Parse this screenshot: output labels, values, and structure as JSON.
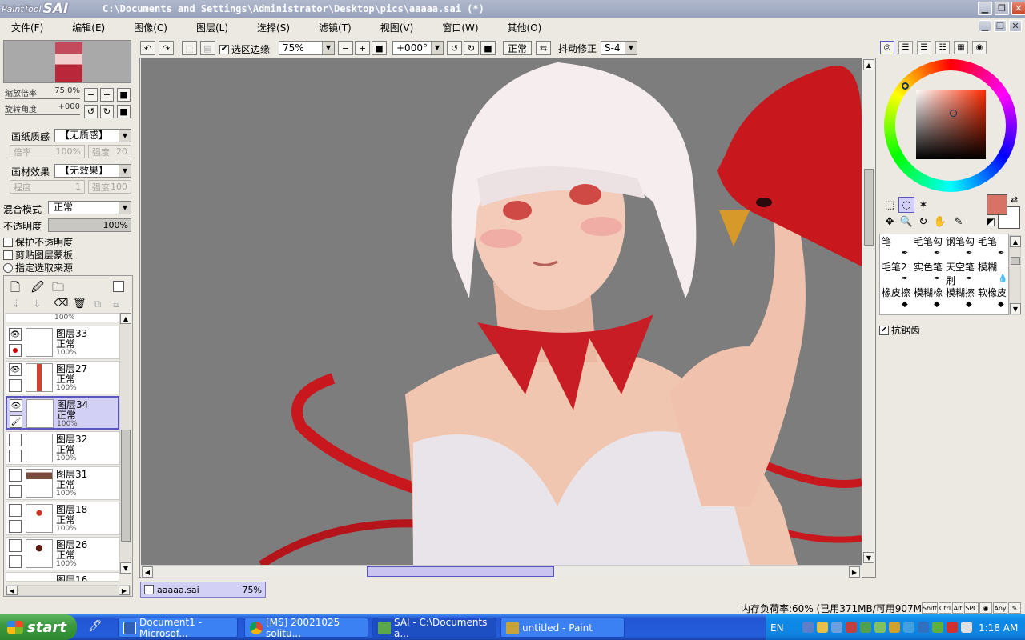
{
  "window": {
    "app_name_small": "PaintTool",
    "app_name_big": "SAI",
    "title": "C:\\Documents and Settings\\Administrator\\Desktop\\pics\\aaaaa.sai (*)"
  },
  "menu": [
    "文件(F)",
    "编辑(E)",
    "图像(C)",
    "图层(L)",
    "选择(S)",
    "滤镜(T)",
    "视图(V)",
    "窗口(W)",
    "其他(O)"
  ],
  "navigator": {
    "zoom_label": "缩放倍率",
    "zoom_value": "75.0%",
    "rotate_label": "旋转角度",
    "rotate_value": "+000"
  },
  "properties": {
    "paper_texture_label": "画纸质感",
    "paper_texture_value": "【无质感】",
    "scale_label": "倍率",
    "scale_value": "100%",
    "strength_label": "强度",
    "strength_value": "20",
    "material_label": "画材效果",
    "material_value": "【无效果】",
    "degree_label": "程度",
    "degree_value": "1",
    "strength2_label": "强度",
    "strength2_value": "100",
    "blend_label": "混合模式",
    "blend_value": "正常",
    "opacity_label": "不透明度",
    "opacity_value": "100%",
    "protect_opacity": "保护不透明度",
    "clip_mask": "剪贴图层蒙板",
    "selection_source": "指定选取来源"
  },
  "layers": [
    {
      "name": "",
      "mode": "",
      "opacity": "100%",
      "selected": false
    },
    {
      "name": "图层33",
      "mode": "正常",
      "opacity": "100%",
      "selected": false
    },
    {
      "name": "图层27",
      "mode": "正常",
      "opacity": "100%",
      "selected": false
    },
    {
      "name": "图层34",
      "mode": "正常",
      "opacity": "100%",
      "selected": true
    },
    {
      "name": "图层32",
      "mode": "正常",
      "opacity": "100%",
      "selected": false
    },
    {
      "name": "图层31",
      "mode": "正常",
      "opacity": "100%",
      "selected": false
    },
    {
      "name": "图层18",
      "mode": "正常",
      "opacity": "100%",
      "selected": false
    },
    {
      "name": "图层26",
      "mode": "正常",
      "opacity": "100%",
      "selected": false
    },
    {
      "name": "图层16",
      "mode": "",
      "opacity": "",
      "selected": false
    }
  ],
  "toolbar": {
    "selection_edge_label": "选区边缘",
    "zoom_value": "75%",
    "angle_value": "+000°",
    "mode_label": "正常",
    "stabilizer_label": "抖动修正",
    "stabilizer_value": "S-4"
  },
  "tools": {
    "brushes": [
      [
        "笔",
        "毛笔勾",
        "钢笔勾",
        "毛笔"
      ],
      [
        "毛笔2",
        "实色笔",
        "天空笔刷",
        "模糊"
      ],
      [
        "橡皮擦",
        "模糊橡",
        "模糊擦",
        "软橡皮"
      ]
    ],
    "antialias_label": "抗锯齿"
  },
  "colors": {
    "foreground": "#d87267",
    "background": "#ffffff",
    "canvas_bg": "#7d7d7d",
    "selection_accent": "#5956c4"
  },
  "document_tab": {
    "name": "aaaaa.sai",
    "zoom": "75%"
  },
  "status": {
    "memory": "内存负荷率:60% (已用371MB/可用907MB)",
    "modifier_keys": [
      "Shift",
      "Ctrl",
      "Alt",
      "SPC",
      "◉",
      "Any"
    ]
  },
  "taskbar": {
    "start_label": "start",
    "tasks": [
      {
        "label": "Document1 - Microsof...",
        "active": false
      },
      {
        "label": "[MS] 20021025 solitu...",
        "active": false
      },
      {
        "label": "SAI - C:\\Documents a...",
        "active": true
      },
      {
        "label": "untitled - Paint",
        "active": false
      }
    ],
    "language": "EN",
    "clock": "1:18 AM"
  }
}
